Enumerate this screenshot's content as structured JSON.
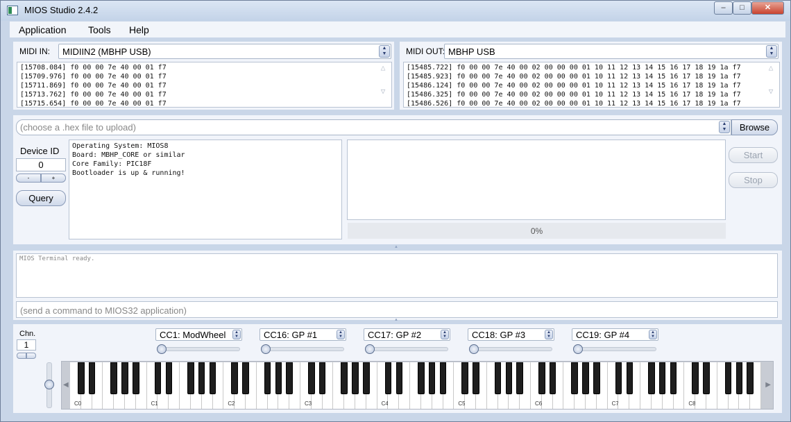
{
  "window": {
    "title": "MIOS Studio 2.4.2",
    "controls": [
      "–",
      "□",
      "✕"
    ]
  },
  "menu": [
    "Application",
    "Tools",
    "Help"
  ],
  "midi_in": {
    "label": "MIDI IN:",
    "device": "MIDIIN2 (MBHP USB)",
    "log": [
      "[15708.084]  f0 00 00 7e 40 00 01 f7",
      "[15709.976]  f0 00 00 7e 40 00 01 f7",
      "[15711.869]  f0 00 00 7e 40 00 01 f7",
      "[15713.762]  f0 00 00 7e 40 00 01 f7",
      "[15715.654]  f0 00 00 7e 40 00 01 f7"
    ]
  },
  "midi_out": {
    "label": "MIDI OUT:",
    "device": "MBHP USB",
    "log": [
      "[15485.722]  f0 00 00 7e 40 00 02 00 00 00 01 10 11 12 13 14 15 16 17 18 19 1a f7",
      "[15485.923]  f0 00 00 7e 40 00 02 00 00 00 01 10 11 12 13 14 15 16 17 18 19 1a f7",
      "[15486.124]  f0 00 00 7e 40 00 02 00 00 00 01 10 11 12 13 14 15 16 17 18 19 1a f7",
      "[15486.325]  f0 00 00 7e 40 00 02 00 00 00 01 10 11 12 13 14 15 16 17 18 19 1a f7",
      "[15486.526]  f0 00 00 7e 40 00 02 00 00 00 01 10 11 12 13 14 15 16 17 18 19 1a f7"
    ]
  },
  "upload": {
    "file_placeholder": "(choose a .hex file to upload)",
    "browse": "Browse",
    "device_id_label": "Device ID",
    "device_id": "0",
    "minus": "-",
    "plus": "+",
    "query": "Query",
    "info": [
      "Operating System: MIOS8",
      "Board: MBHP_CORE or similar",
      "Core Family: PIC18F",
      "Bootloader is up & running!"
    ],
    "start": "Start",
    "stop": "Stop",
    "progress": "0%",
    "progress_value": 0
  },
  "terminal": {
    "output": "MIOS Terminal ready.",
    "command_placeholder": "(send a command to MIOS32 application)"
  },
  "keyboard": {
    "chn_label": "Chn.",
    "channel": "1",
    "cc": [
      {
        "label": "CC1: ModWheel",
        "value": 0
      },
      {
        "label": "CC16: GP #1",
        "value": 0
      },
      {
        "label": "CC17: GP #2",
        "value": 0
      },
      {
        "label": "CC18: GP #3",
        "value": 0
      },
      {
        "label": "CC19: GP #4",
        "value": 0
      }
    ],
    "octave_labels": [
      "C0",
      "C1",
      "C2",
      "C3",
      "C4",
      "C5",
      "C6",
      "C7",
      "C8"
    ]
  },
  "colors": {
    "background": "#c9d6e8",
    "panel": "#f1f4fa",
    "accent": "#8fa2c0"
  }
}
